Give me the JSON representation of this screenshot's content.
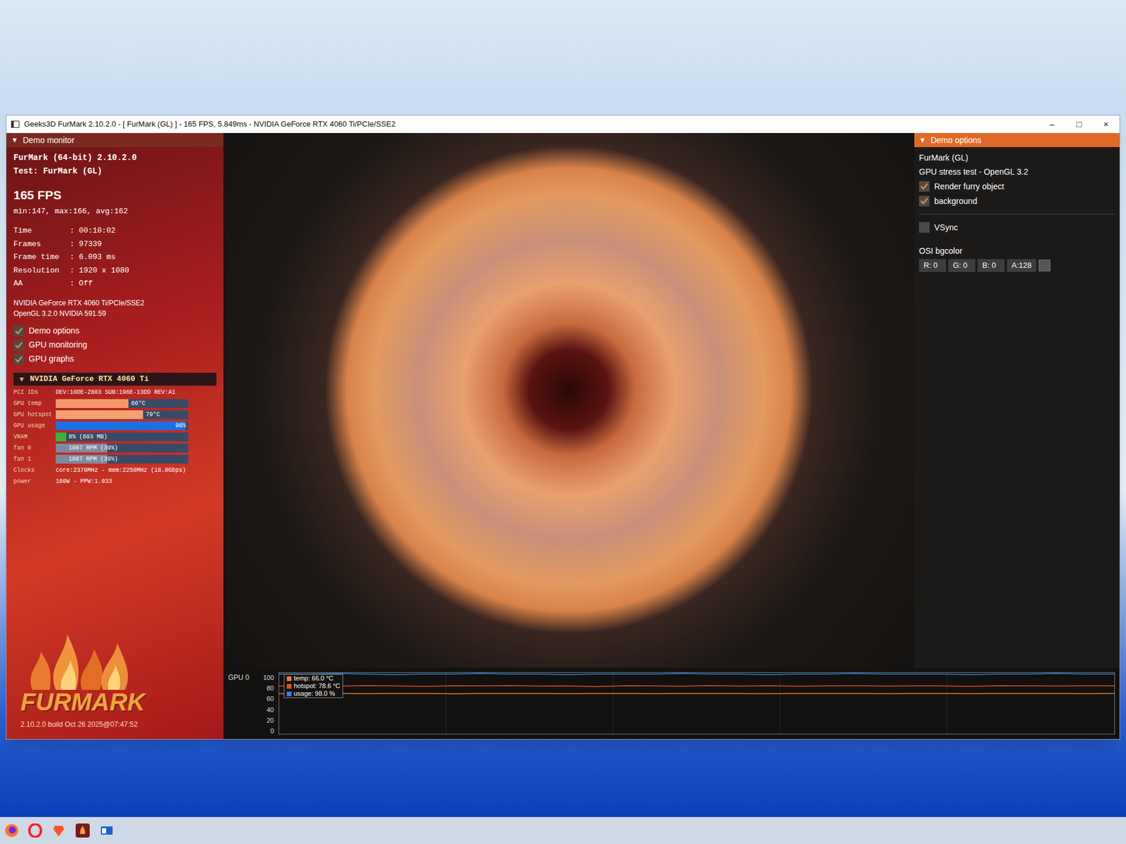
{
  "window": {
    "title": "Geeks3D FurMark 2.10.2.0 - [ FurMark (GL) ] - 165 FPS, 5.849ms - NVIDIA GeForce RTX 4060 Ti/PCIe/SSE2",
    "controls": [
      "–",
      "□",
      "×"
    ]
  },
  "monitor": {
    "arrow": "▼",
    "header": "Demo monitor",
    "expanded": true,
    "lines": [
      "FurMark (64-bit) 2.10.2.0",
      "Test: FurMark (GL)"
    ],
    "fps": "165 FPS",
    "fps_stats": "min:147, max:166, avg:162",
    "stats": [
      {
        "label": "Time",
        "value": ": 00:10:02"
      },
      {
        "label": "Frames",
        "value": ": 97339"
      },
      {
        "label": "Frame time",
        "value": ": 6.093 ms"
      },
      {
        "label": "Resolution",
        "value": ": 1920 x 1080"
      },
      {
        "label": "AA",
        "value": ": Off"
      }
    ],
    "renderer": [
      "NVIDIA GeForce RTX 4060 Ti/PCIe/SSE2",
      "OpenGL 3.2.0 NVIDIA 591.59"
    ],
    "toggles": [
      {
        "label": "Demo options",
        "checked": true
      },
      {
        "label": "GPU monitoring",
        "checked": true
      },
      {
        "label": "GPU graphs",
        "checked": true
      }
    ]
  },
  "gpu": {
    "arrow": "▼",
    "name": "NVIDIA GeForce RTX 4060 Ti",
    "expanded": true,
    "rows": [
      {
        "kind": "text",
        "label": "PCI IDs",
        "value": "DEV:10DE-2803 SUB:196E-13DD REV:A1"
      },
      {
        "kind": "bar",
        "label": "GPU temp",
        "value": "66°C",
        "level": 0.55,
        "color": "#f29a6a"
      },
      {
        "kind": "bar",
        "label": "GPU hotspot",
        "value": "79°C",
        "level": 0.66,
        "color": "#f4a070"
      },
      {
        "kind": "bar",
        "label": "GPU usage",
        "value": "98%",
        "level": 0.98,
        "color": "#1f6fe0"
      },
      {
        "kind": "bar",
        "label": "VRAM",
        "value": "8% (693 MB)",
        "level": 0.08,
        "color": "#3cb043"
      },
      {
        "kind": "bar",
        "label": "fan 0",
        "value": "1087 RPM (39%)",
        "level": 0.39,
        "color": "#7d8aa0"
      },
      {
        "kind": "bar",
        "label": "fan 1",
        "value": "1087 RPM (39%)",
        "level": 0.39,
        "color": "#7d8aa0"
      },
      {
        "kind": "text",
        "label": "Clocks",
        "value": "core:2370MHz - mem:2250MHz (18.0Gbps)"
      },
      {
        "kind": "text",
        "label": "power",
        "value": "160W - PPW:1.033"
      }
    ]
  },
  "logo": {
    "text": "FURMARK",
    "build": "2.10.2.0 build Oct 26 2025@07:47:52"
  },
  "options": {
    "arrow": "▼",
    "header": "Demo options",
    "expanded": true,
    "lines": [
      "FurMark (GL)",
      "GPU stress test - OpenGL 3.2"
    ],
    "checks": [
      {
        "label": "Render furry object",
        "checked": true
      },
      {
        "label": "background",
        "checked": true
      }
    ],
    "vsync": {
      "label": "VSync",
      "checked": false
    },
    "bgcolor": {
      "label": "OSI bgcolor",
      "fields": [
        "R: 0",
        "G: 0",
        "B: 0",
        "A:128"
      ]
    }
  },
  "graph": {
    "label": "GPU 0",
    "ticks": [
      "100",
      "80",
      "60",
      "40",
      "20",
      "0"
    ],
    "series": [
      {
        "name": "temp",
        "legend": "temp: 66.0 °C",
        "color": "#f07a3a",
        "values": [
          65.8,
          66.0,
          66.1,
          65.9,
          66.0,
          66.2,
          65.7,
          66.0,
          66.1,
          66.0,
          65.9,
          66.1,
          66.0,
          65.8,
          66.0,
          66.2,
          66.0,
          65.9,
          66.1,
          66.0,
          66.0,
          65.8,
          66.1,
          66.0,
          65.9,
          66.0,
          66.2,
          66.0,
          65.9,
          66.0
        ]
      },
      {
        "name": "hotspot",
        "legend": "hotspot: 78.6 °C",
        "color": "#e0502a",
        "values": [
          78.4,
          78.9,
          78.2,
          79.1,
          78.6,
          77.8,
          78.8,
          78.5,
          79.0,
          78.3,
          78.7,
          77.5,
          78.9,
          78.6,
          78.2,
          79.0,
          78.4,
          78.8,
          78.1,
          78.6,
          78.9,
          78.3,
          78.7,
          78.5,
          77.9,
          78.8,
          78.6,
          78.4,
          78.9,
          78.6
        ]
      },
      {
        "name": "usage",
        "legend": "usage: 98.0 %",
        "color": "#2f7fe8",
        "values": [
          98,
          98,
          99,
          98,
          97,
          98,
          98,
          99,
          98,
          98,
          97,
          98,
          98,
          98,
          99,
          98,
          98,
          97,
          98,
          98,
          99,
          98,
          98,
          98,
          97,
          98,
          98,
          99,
          98,
          98
        ]
      }
    ]
  }
}
